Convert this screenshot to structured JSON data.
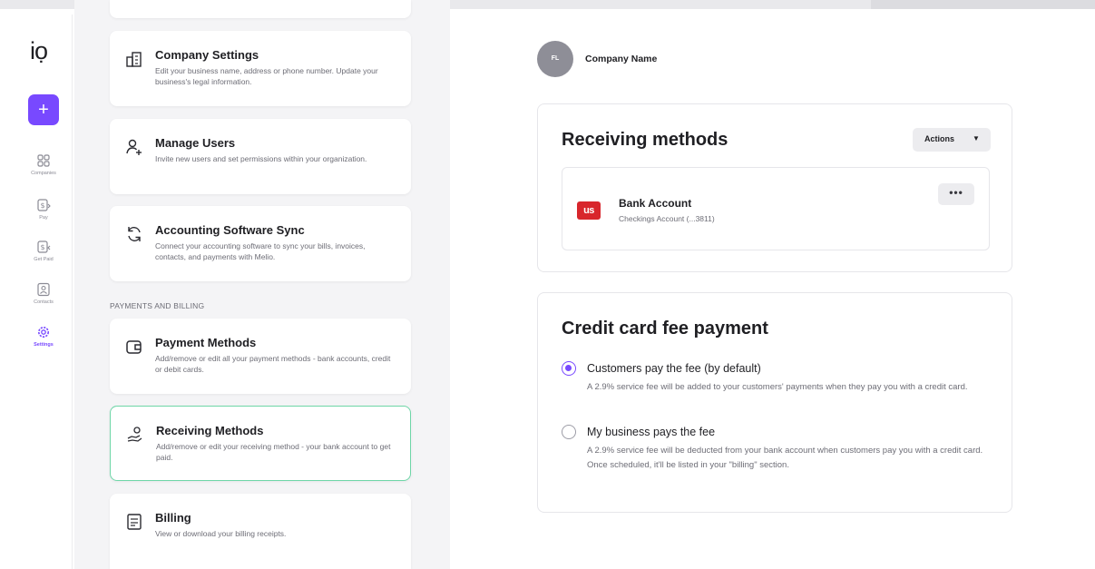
{
  "app": {
    "logo_text": "iọ",
    "new_button_label": "+"
  },
  "rail": {
    "items": [
      {
        "label": "Companies",
        "icon": "companies-icon"
      },
      {
        "label": "Pay",
        "icon": "pay-icon"
      },
      {
        "label": "Get Paid",
        "icon": "get-paid-icon"
      },
      {
        "label": "Contacts",
        "icon": "contacts-icon"
      },
      {
        "label": "Settings",
        "icon": "gear-icon",
        "active": true
      }
    ]
  },
  "settings": {
    "cards": [
      {
        "title": "Company Settings",
        "desc": "Edit your business name, address or phone number. Update your business's legal information.",
        "icon": "building-icon"
      },
      {
        "title": "Manage Users",
        "desc": "Invite new users and set permissions within your organization.",
        "icon": "add-user-icon"
      },
      {
        "title": "Accounting Software Sync",
        "desc": "Connect your accounting software to sync your bills, invoices, contacts, and payments with Melio.",
        "icon": "sync-icon"
      },
      {
        "title": "Payment Methods",
        "desc": "Add/remove or edit all your payment methods - bank accounts, credit or debit cards.",
        "icon": "wallet-icon"
      },
      {
        "title": "Receiving Methods",
        "desc": "Add/remove or edit your receiving method - your bank account to get paid.",
        "icon": "receive-money-icon",
        "selected": true
      },
      {
        "title": "Billing",
        "desc": "View or download your billing receipts.",
        "icon": "receipt-icon"
      }
    ],
    "section_payments": "PAYMENTS AND BILLING"
  },
  "company": {
    "initials": "FL",
    "name": "Company Name"
  },
  "receiving": {
    "title": "Receiving methods",
    "actions_label": "Actions",
    "method": {
      "logo_text": "us",
      "title": "Bank Account",
      "subtitle": "Checkings Account (...3811)",
      "more_label": "•••"
    }
  },
  "fee": {
    "title": "Credit card fee payment",
    "options": [
      {
        "title": "Customers pay the fee (by default)",
        "desc": "A 2.9% service fee will be added to your customers' payments when they pay you with a credit card.",
        "checked": true
      },
      {
        "title": "My business pays the fee",
        "desc": "A 2.9% service fee will be deducted from your bank account when customers pay you with a credit card. Once scheduled, it'll be listed in your \"billing\" section.",
        "checked": false
      }
    ]
  },
  "colors": {
    "accent": "#7849ff",
    "selected_border": "#6fd6a8",
    "bank_logo": "#d8262c"
  }
}
